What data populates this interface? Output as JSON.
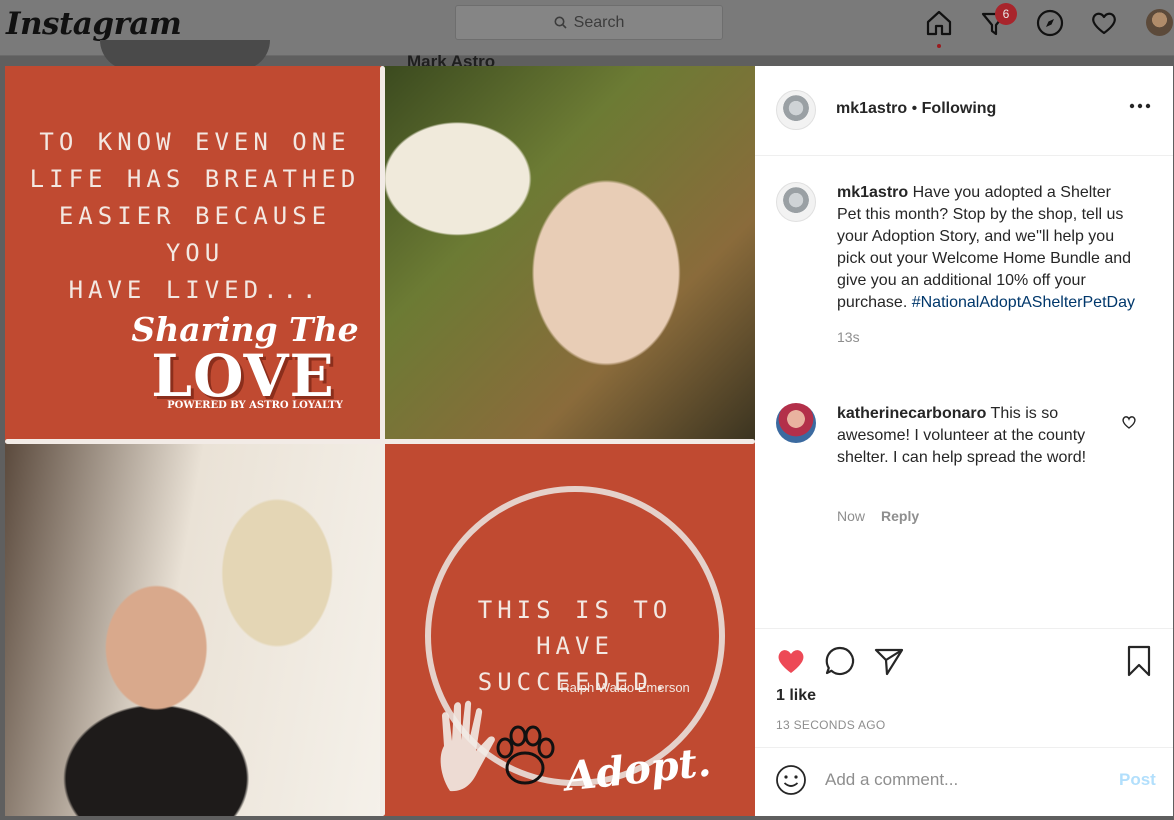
{
  "app": {
    "logo_text": "Instagram"
  },
  "search": {
    "placeholder": "Search"
  },
  "nav": {
    "activity_badge_count": "6",
    "icons": [
      "home-icon",
      "activity-filter-icon",
      "explore-compass-icon",
      "heart-icon"
    ]
  },
  "background": {
    "profile_name": "Mark Astro"
  },
  "media": {
    "quote_lines": [
      "TO KNOW EVEN ONE",
      "LIFE HAS BREATHED",
      "EASIER BECAUSE YOU",
      "HAVE LIVED..."
    ],
    "sharing_text": "Sharing The",
    "love_text": "LOVE",
    "powered_text": "POWERED BY ASTRO LOYALTY",
    "succeeded_lines": [
      "THIS IS TO HAVE",
      "SUCCEEDED."
    ],
    "attribution": "Ralph Waldo Emerson",
    "adopt_text": "Adopt."
  },
  "post": {
    "author": "mk1astro",
    "follow_status": "Following",
    "caption": "Have you adopted a Shelter Pet this month? Stop by the shop, tell us your Adoption Story, and we''ll help you pick out your Welcome Home Bundle and give you an additional 10% off your purchase.",
    "hashtag": "#NationalAdoptAShelterPetDay",
    "caption_age": "13s",
    "likes": "1 like",
    "posted_time": "13 SECONDS AGO",
    "liked": true,
    "accent_like_color": "#ed4956"
  },
  "comments": [
    {
      "user": "katherinecarbonaro",
      "text": "This is so awesome! I volunteer at the county shelter. I can help spread the word!",
      "age": "Now",
      "reply_label": "Reply"
    }
  ],
  "comment_box": {
    "placeholder": "Add a comment...",
    "post_label": "Post"
  }
}
